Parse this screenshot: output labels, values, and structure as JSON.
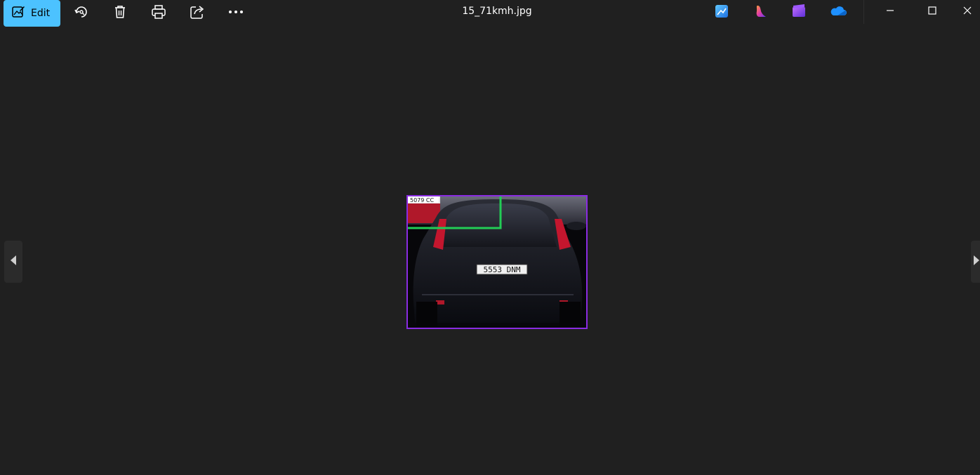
{
  "toolbar": {
    "edit_label": "Edit",
    "icons": [
      "edit-image-icon",
      "rotate-icon",
      "delete-icon",
      "print-icon",
      "share-icon",
      "more-icon"
    ]
  },
  "window": {
    "title": "15_71kmh.jpg",
    "app_icons": [
      "photos-app-icon",
      "copilot-icon",
      "clipchamp-icon",
      "onedrive-icon"
    ]
  },
  "photo": {
    "plate_text": "5553 DNM",
    "overlay_text": "5079 CC",
    "colors": {
      "frame": "#8a2be2",
      "line": "#22cc55"
    }
  },
  "colors": {
    "background": "#202020",
    "accent": "#4cc2ff"
  }
}
